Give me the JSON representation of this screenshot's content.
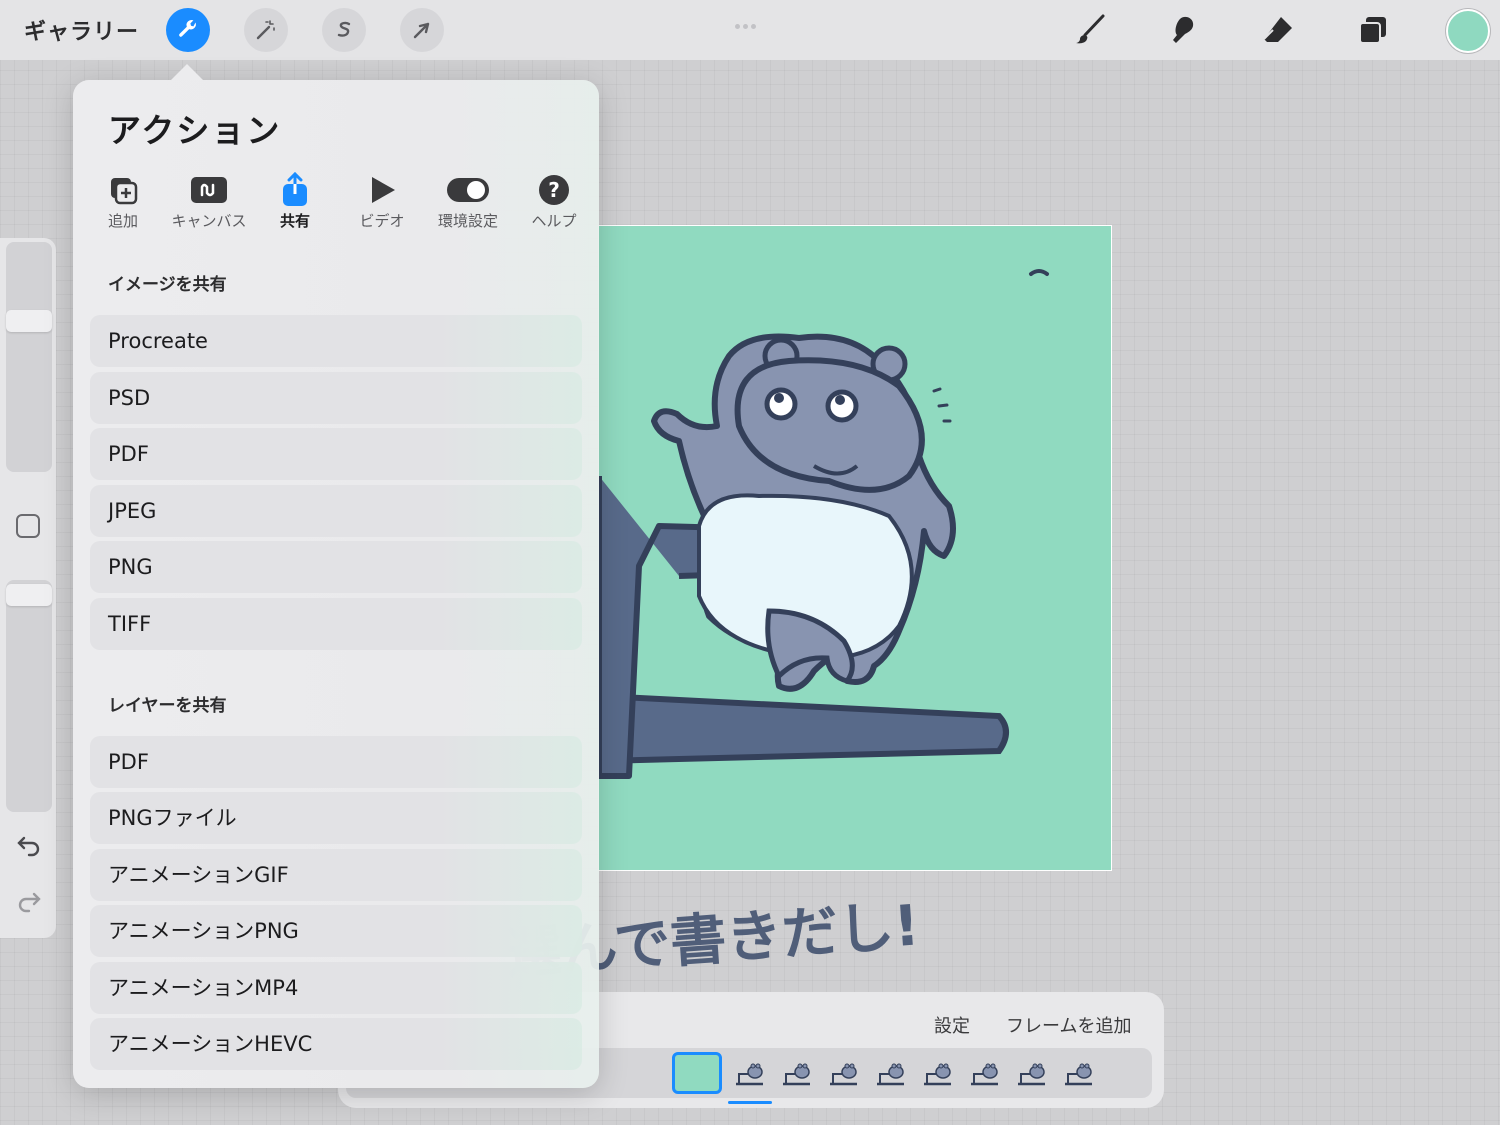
{
  "topbar": {
    "gallery_label": "ギャラリー",
    "left_tools": [
      {
        "name": "actions-wrench",
        "active": true
      },
      {
        "name": "adjustments-wand",
        "active": false
      },
      {
        "name": "selection-s",
        "active": false
      },
      {
        "name": "transform-arrow",
        "active": false
      }
    ],
    "right_tools": [
      "brush",
      "smudge",
      "eraser",
      "layers"
    ],
    "current_color": "#8fd9c0",
    "accent_color": "#1a8cff"
  },
  "actions": {
    "title": "アクション",
    "tabs": [
      {
        "label": "追加",
        "icon": "add-icon",
        "active": false
      },
      {
        "label": "キャンバス",
        "icon": "canvas-icon",
        "active": false
      },
      {
        "label": "共有",
        "icon": "share-icon",
        "active": true
      },
      {
        "label": "ビデオ",
        "icon": "video-play-icon",
        "active": false
      },
      {
        "label": "環境設定",
        "icon": "toggle-icon",
        "active": false
      },
      {
        "label": "ヘルプ",
        "icon": "help-icon",
        "active": false
      }
    ],
    "share_image": {
      "heading": "イメージを共有",
      "items": [
        "Procreate",
        "PSD",
        "PDF",
        "JPEG",
        "PNG",
        "TIFF"
      ]
    },
    "share_layers": {
      "heading": "レイヤーを共有",
      "items": [
        "PDF",
        "PNGファイル",
        "アニメーションGIF",
        "アニメーションPNG",
        "アニメーションMP4",
        "アニメーションHEVC"
      ]
    }
  },
  "annotation": {
    "handwritten_text": "選んで書きだし!"
  },
  "animation_assist": {
    "settings_label": "設定",
    "add_frame_label": "フレームを追加",
    "frame_count": 9,
    "selected_frame": 1
  }
}
